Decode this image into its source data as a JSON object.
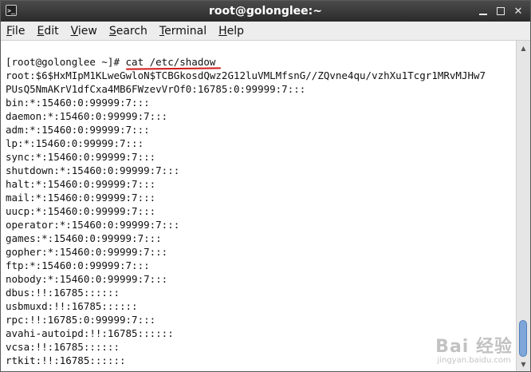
{
  "window": {
    "title": "root@golonglee:~"
  },
  "menu": {
    "items": [
      {
        "mnemonic": "F",
        "rest": "ile"
      },
      {
        "mnemonic": "E",
        "rest": "dit"
      },
      {
        "mnemonic": "V",
        "rest": "iew"
      },
      {
        "mnemonic": "S",
        "rest": "earch"
      },
      {
        "mnemonic": "T",
        "rest": "erminal"
      },
      {
        "mnemonic": "H",
        "rest": "elp"
      }
    ]
  },
  "terminal": {
    "prompt": "[root@golonglee ~]# ",
    "command": "cat /etc/shadow",
    "output": [
      "root:$6$HxMIpM1KLweGwloN$TCBGkosdQwz2G12luVMLMfsnG//ZQvne4qu/vzhXu1Tcgr1MRvMJHw7",
      "PUsQ5NmAKrV1dfCxa4MB6FWzevVrOf0:16785:0:99999:7:::",
      "bin:*:15460:0:99999:7:::",
      "daemon:*:15460:0:99999:7:::",
      "adm:*:15460:0:99999:7:::",
      "lp:*:15460:0:99999:7:::",
      "sync:*:15460:0:99999:7:::",
      "shutdown:*:15460:0:99999:7:::",
      "halt:*:15460:0:99999:7:::",
      "mail:*:15460:0:99999:7:::",
      "uucp:*:15460:0:99999:7:::",
      "operator:*:15460:0:99999:7:::",
      "games:*:15460:0:99999:7:::",
      "gopher:*:15460:0:99999:7:::",
      "ftp:*:15460:0:99999:7:::",
      "nobody:*:15460:0:99999:7:::",
      "dbus:!!:16785::::::",
      "usbmuxd:!!:16785::::::",
      "rpc:!!:16785:0:99999:7:::",
      "avahi-autoipd:!!:16785::::::",
      "vcsa:!!:16785::::::",
      "rtkit:!!:16785::::::"
    ]
  },
  "watermark": {
    "logo": "Bai 经验",
    "url": "jingyan.baidu.com"
  },
  "colors": {
    "titlebar": "#2b2b2b",
    "annotation_underline": "#d11a1a",
    "scroll_thumb": "#7ea6d8"
  }
}
